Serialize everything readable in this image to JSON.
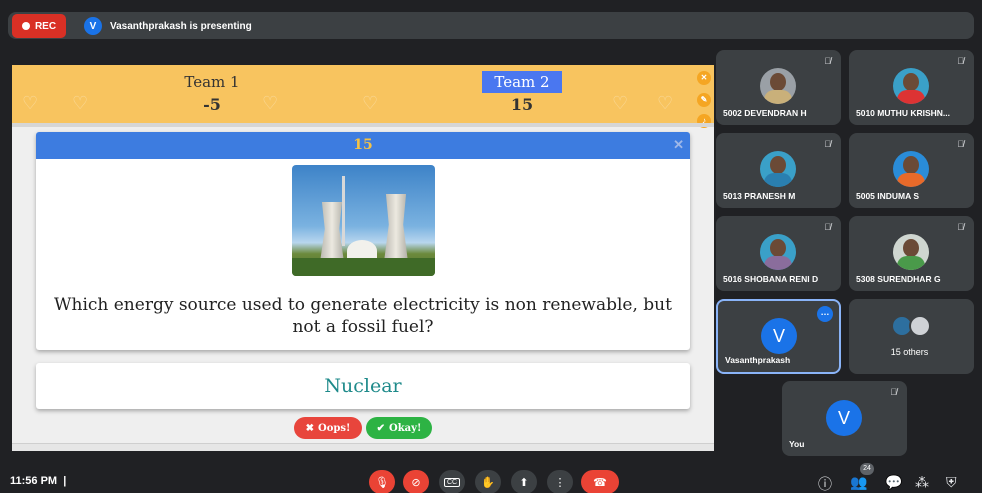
{
  "top": {
    "rec_label": "REC",
    "presenter_initial": "V",
    "presenting_text": "Vasanthprakash is presenting"
  },
  "quiz": {
    "team1": {
      "name": "Team 1",
      "score": "-5"
    },
    "team2": {
      "name": "Team 2",
      "score": "15"
    },
    "question_points": "15",
    "question": "Which energy source used to generate electricity is non renewable, but not a fossil fuel?",
    "answer": "Nuclear",
    "oops_label": "Oops!",
    "okay_label": "Okay!"
  },
  "participants": [
    {
      "name": "5002 DEVENDRAN H"
    },
    {
      "name": "5010 MUTHU KRISHN..."
    },
    {
      "name": "5013 PRANESH M"
    },
    {
      "name": "5005 INDUMA S"
    },
    {
      "name": "5016 SHOBANA RENI D"
    },
    {
      "name": "5308 SURENDHAR G"
    },
    {
      "name": "Vasanthprakash",
      "initial": "V"
    },
    {
      "name": "15 others"
    }
  ],
  "self_tile": {
    "name": "You",
    "initial": "V"
  },
  "bottom": {
    "time": "11:56 PM",
    "people_count": "24"
  },
  "colors": {
    "meet_bg": "#202124",
    "tile_bg": "#3c4043",
    "end_call": "#ea4335",
    "scoreboard": "#f8c45f",
    "question_header": "#3d7ce0",
    "answer_text": "#1e8a8a"
  }
}
